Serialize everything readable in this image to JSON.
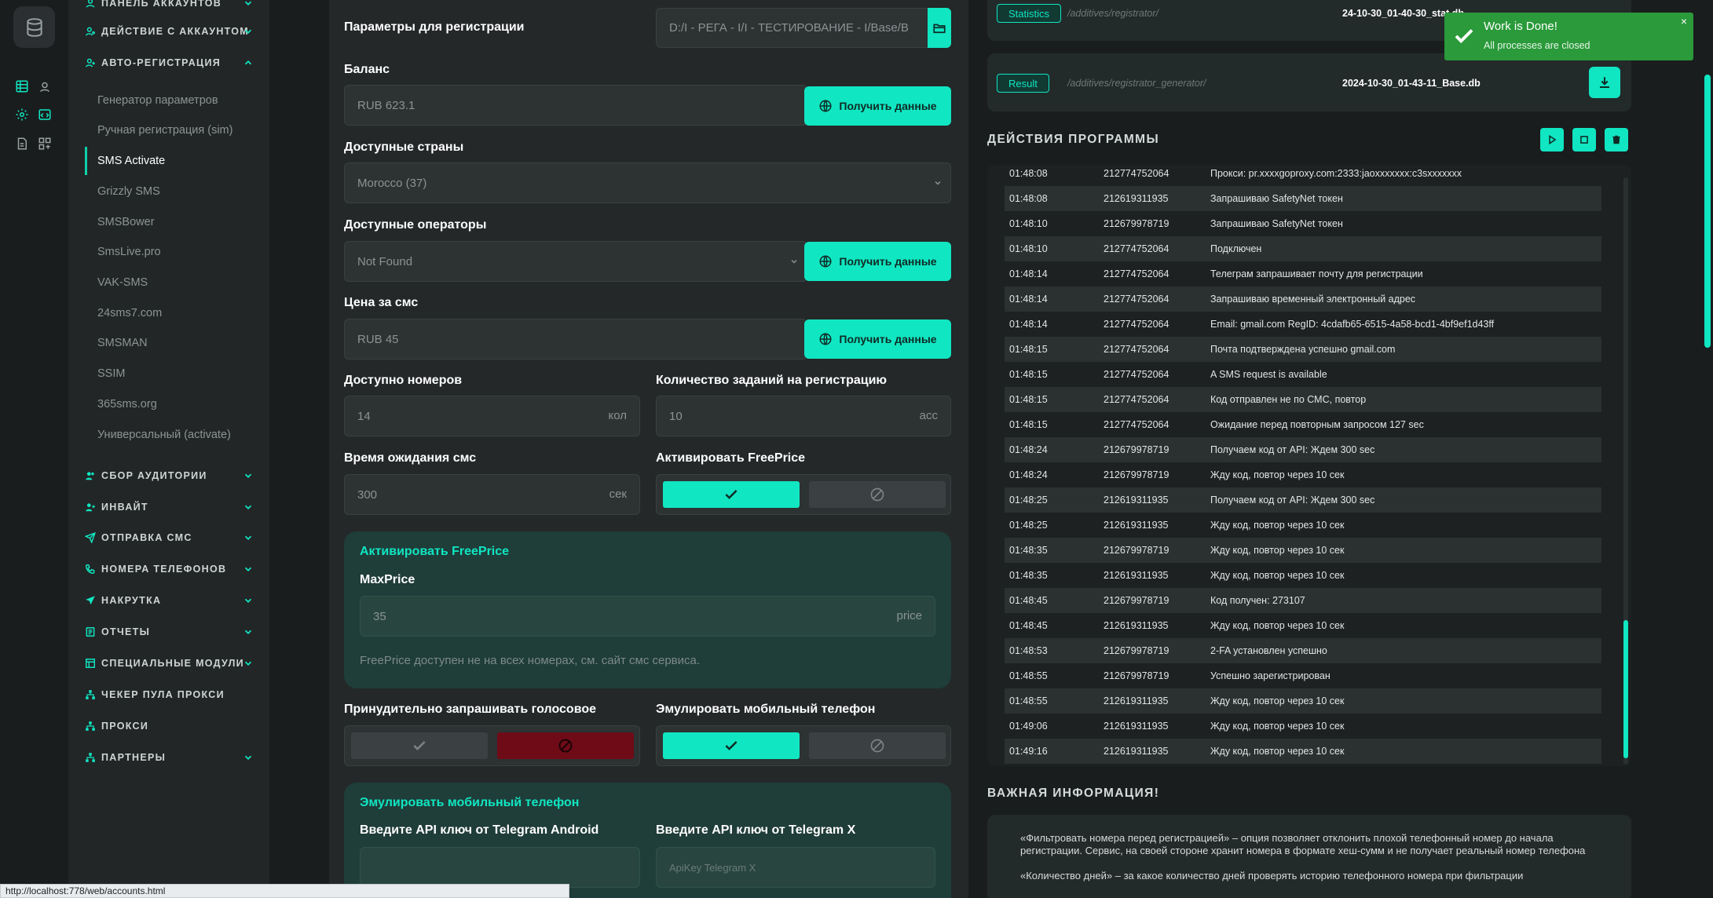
{
  "sidebar": {
    "sections_top": [
      {
        "label": "Панель аккаунтов"
      },
      {
        "label": "Действие с аккаунтом"
      },
      {
        "label": "Авто-регистрация"
      }
    ],
    "items": [
      {
        "label": "Генератор параметров"
      },
      {
        "label": "Ручная регистрация (sim)"
      },
      {
        "label": "SMS Activate"
      },
      {
        "label": "Grizzly SMS"
      },
      {
        "label": "SMSBower"
      },
      {
        "label": "SmsLive.pro"
      },
      {
        "label": "VAK-SMS"
      },
      {
        "label": "24sms7.com"
      },
      {
        "label": "SMSMAN"
      },
      {
        "label": "SSIM"
      },
      {
        "label": "365sms.org"
      },
      {
        "label": "Универсальный (activate)"
      }
    ],
    "sections_bottom": [
      {
        "label": "Сбор аудитории"
      },
      {
        "label": "Инвайт"
      },
      {
        "label": "Отправка смс"
      },
      {
        "label": "Номера телефонов"
      },
      {
        "label": "Накрутка"
      },
      {
        "label": "Отчеты"
      },
      {
        "label": "Специальные модули"
      },
      {
        "label": "Чекер пула прокси"
      },
      {
        "label": "Прокси"
      },
      {
        "label": "Партнеры"
      }
    ]
  },
  "form": {
    "params_label": "Параметры для регистрации",
    "params_value": "D:/I - РЕГА - I/I - ТЕСТИРОВАНИЕ - I/Base/B",
    "balance_label": "Баланс",
    "balance_value": "RUB   623.1",
    "get_data": "Получить данные",
    "countries_label": "Доступные страны",
    "countries_value": "Morocco (37)",
    "operators_label": "Доступные операторы",
    "operators_value": "Not Found",
    "price_label": "Цена за смс",
    "price_value": "RUB   45",
    "numbers_label": "Доступно номеров",
    "numbers_value": "14",
    "numbers_suffix": "кол",
    "tasks_label": "Количество заданий на регистрацию",
    "tasks_value": "10",
    "tasks_suffix": "acc",
    "wait_label": "Время ожидания смс",
    "wait_value": "300",
    "wait_suffix": "сек",
    "freeprice_label": "Активировать FreePrice",
    "freeprice_card_title": "Активировать FreePrice",
    "maxprice_label": "MaxPrice",
    "maxprice_value": "35",
    "maxprice_suffix": "price",
    "freeprice_note": "FreePrice доступен не на всех номерах, см. сайт смс сервиса.",
    "voice_label": "Принудительно запрашивать голосовое",
    "emulate_label": "Эмулировать мобильный телефон",
    "emulate_card_title": "Эмулировать мобильный телефон",
    "api_android_label": "Введите API ключ от Telegram Android",
    "api_x_label": "Введите API ключ от Telegram X",
    "api_x_placeholder": "ApiKey Telegram X"
  },
  "files": [
    {
      "tag": "Statistics",
      "path": "/additives/registrator/",
      "name": "24-10-30_01-40-30_stat.db"
    },
    {
      "tag": "Result",
      "path": "/additives/registrator_generator/",
      "name": "2024-10-30_01-43-11_Base.db"
    }
  ],
  "actions_title": "ДЕЙСТВИЯ ПРОГРАММЫ",
  "log": [
    {
      "t": "01:48:08",
      "n": "212774752064",
      "m": "Прокси: pr.xxxxgoproxy.com:2333:jaoxxxxxxx:c3sxxxxxxx"
    },
    {
      "t": "01:48:08",
      "n": "212619311935",
      "m": "Запрашиваю SafetyNet токен"
    },
    {
      "t": "01:48:10",
      "n": "212679978719",
      "m": "Запрашиваю SafetyNet токен"
    },
    {
      "t": "01:48:10",
      "n": "212774752064",
      "m": "Подключен"
    },
    {
      "t": "01:48:14",
      "n": "212774752064",
      "m": "Телеграм запрашивает почту для регистрации"
    },
    {
      "t": "01:48:14",
      "n": "212774752064",
      "m": "Запрашиваю временный электронный адрес"
    },
    {
      "t": "01:48:14",
      "n": "212774752064",
      "m": "Email: gmail.com RegID: 4cdafb65-6515-4a58-bcd1-4bf9ef1d43ff"
    },
    {
      "t": "01:48:15",
      "n": "212774752064",
      "m": "Почта подтверждена успешно gmail.com"
    },
    {
      "t": "01:48:15",
      "n": "212774752064",
      "m": "A SMS request is available"
    },
    {
      "t": "01:48:15",
      "n": "212774752064",
      "m": "Код отправлен не по СМС, повтор"
    },
    {
      "t": "01:48:15",
      "n": "212774752064",
      "m": "Ожидание перед повторным запросом 127 sec"
    },
    {
      "t": "01:48:24",
      "n": "212679978719",
      "m": "Получаем код от API: Ждем 300 sec"
    },
    {
      "t": "01:48:24",
      "n": "212679978719",
      "m": "Жду код, повтор через 10 сек"
    },
    {
      "t": "01:48:25",
      "n": "212619311935",
      "m": "Получаем код от API: Ждем 300 sec"
    },
    {
      "t": "01:48:25",
      "n": "212619311935",
      "m": "Жду код, повтор через 10 сек"
    },
    {
      "t": "01:48:35",
      "n": "212679978719",
      "m": "Жду код, повтор через 10 сек"
    },
    {
      "t": "01:48:35",
      "n": "212619311935",
      "m": "Жду код, повтор через 10 сек"
    },
    {
      "t": "01:48:45",
      "n": "212679978719",
      "m": "Код получен: 273107"
    },
    {
      "t": "01:48:45",
      "n": "212619311935",
      "m": "Жду код, повтор через 10 сек"
    },
    {
      "t": "01:48:53",
      "n": "212679978719",
      "m": "2-FA установлен успешно"
    },
    {
      "t": "01:48:55",
      "n": "212679978719",
      "m": "Успешно зарегистрирован"
    },
    {
      "t": "01:48:55",
      "n": "212619311935",
      "m": "Жду код, повтор через 10 сек"
    },
    {
      "t": "01:49:06",
      "n": "212619311935",
      "m": "Жду код, повтор через 10 сек"
    },
    {
      "t": "01:49:16",
      "n": "212619311935",
      "m": "Жду код, повтор через 10 сек"
    }
  ],
  "info_title": "ВАЖНАЯ ИНФОРМАЦИЯ!",
  "info": [
    "«Фильтровать номера перед регистрацией» – опция позволяет отклонить плохой телефонный номер до начала регистрации. Сервис, на своей стороне хранит номера в формате хеш-сумм и не получает реальный номер телефона",
    "«Количество дней» – за какое количество дней проверять историю телефонного номера при фильтрации"
  ],
  "toast": {
    "title": "Work is Done!",
    "body": "All processes are closed"
  },
  "status_url": "http://localhost:778/web/accounts.html",
  "colors": {
    "accent": "#10e6c2",
    "danger": "#6f0b17",
    "success": "#2a9a3a"
  }
}
